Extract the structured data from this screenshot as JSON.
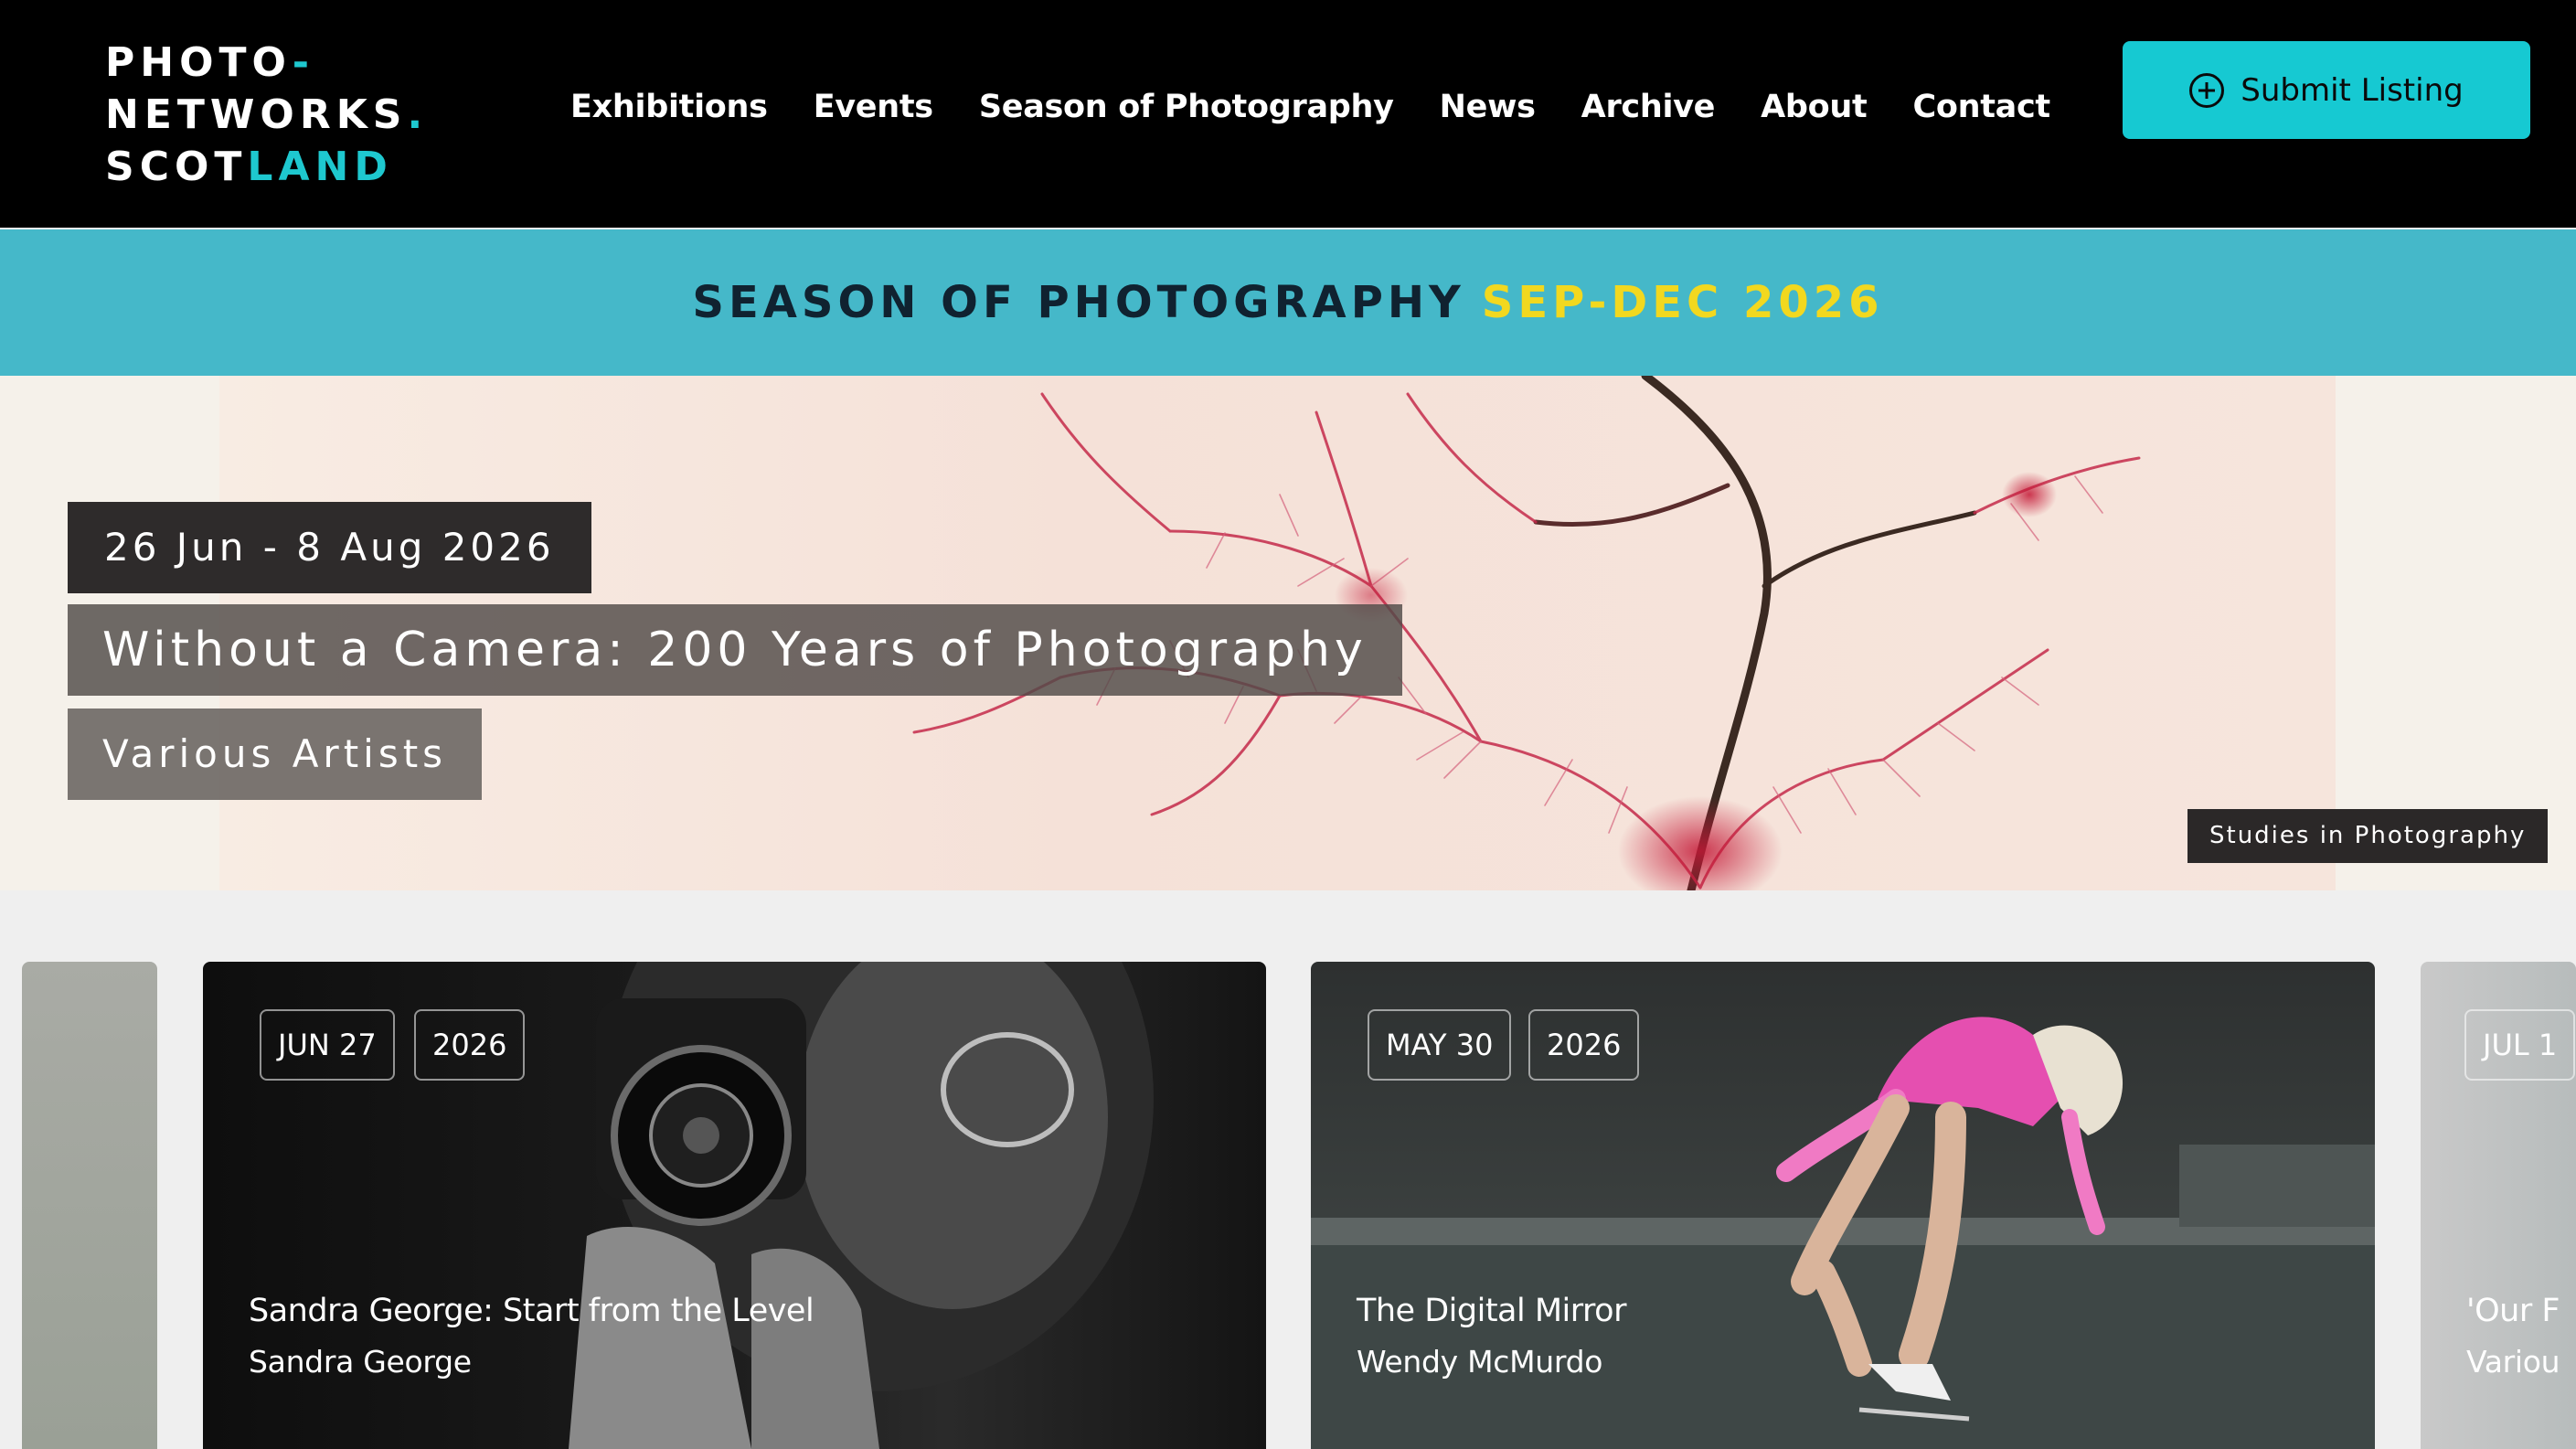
{
  "logo": {
    "line1": "PHOTO",
    "line1_accent": "-",
    "line2": "NETWORKS",
    "line2_accent": ".",
    "line3": "SCOT",
    "line3_accent": "LAND"
  },
  "nav": {
    "items": [
      "Exhibitions",
      "Events",
      "Season of Photography",
      "News",
      "Archive",
      "About",
      "Contact"
    ]
  },
  "submit": {
    "label": "Submit Listing",
    "icon": "plus-circle-icon"
  },
  "season_banner": {
    "text": "SEASON OF PHOTOGRAPHY",
    "highlight": "SEP-DEC 2026"
  },
  "hero": {
    "date": "26 Jun - 8 Aug 2026",
    "title": "Without a Camera: 200 Years of Photography",
    "artist": "Various Artists",
    "credit": "Studies in Photography"
  },
  "cards": [
    {
      "month_day": "JUN 27",
      "year": "2026",
      "title": "Sandra George: Start from the Level",
      "artist": "Sandra George"
    },
    {
      "month_day": "MAY 30",
      "year": "2026",
      "title": "The Digital Mirror",
      "artist": "Wendy McMurdo"
    },
    {
      "month_day": "JUL 1",
      "title": "'Our F",
      "artist": "Variou"
    }
  ],
  "colors": {
    "accent": "#1ec8cf",
    "banner": "#45b8c9",
    "banner_highlight": "#f2d81f",
    "header_bg": "#000000"
  }
}
